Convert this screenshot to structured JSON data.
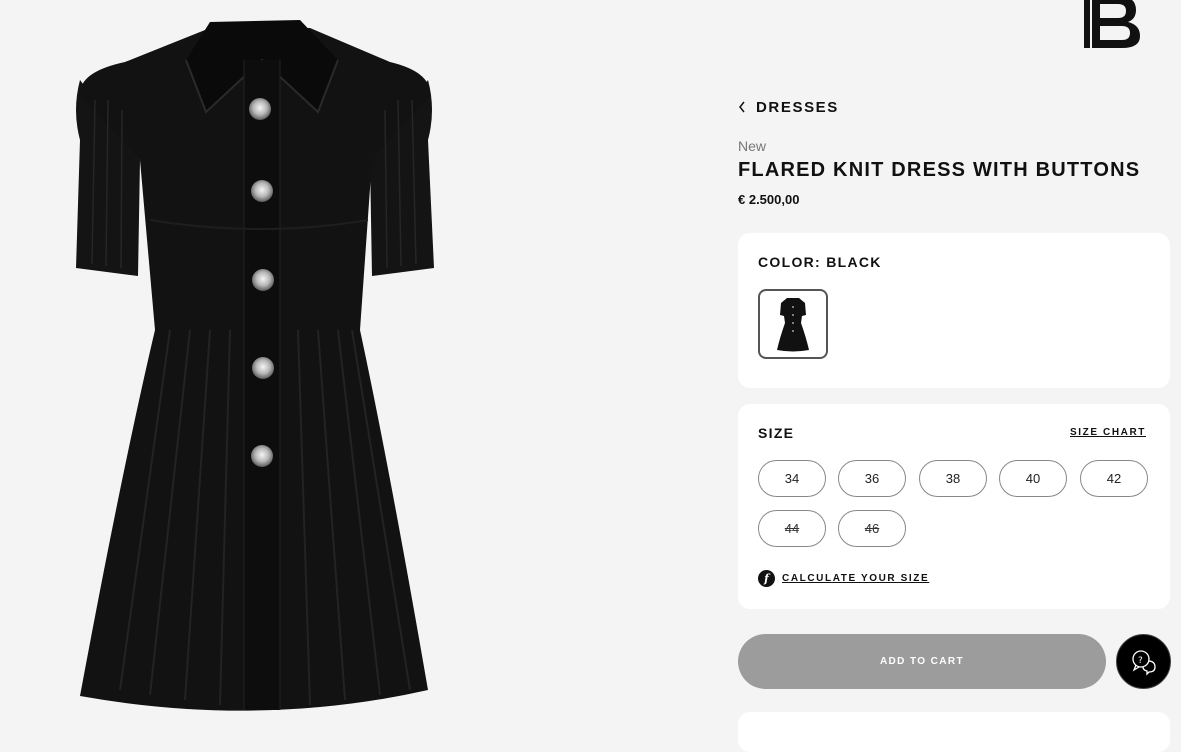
{
  "brand": {
    "logo_letter": "B"
  },
  "breadcrumb": {
    "icon": "chevron-left-icon",
    "label": "DRESSES"
  },
  "product": {
    "badge": "New",
    "title": "FLARED KNIT DRESS WITH BUTTONS",
    "price": "€ 2.500,00",
    "image_alt": "Black flared knit dress with silver buttons"
  },
  "color": {
    "label": "COLOR: BLACK",
    "swatches": [
      {
        "name": "black",
        "selected": true,
        "hex": "#111111"
      }
    ]
  },
  "size": {
    "label": "SIZE",
    "chart_link": "SIZE CHART",
    "options": [
      {
        "label": "34",
        "available": true
      },
      {
        "label": "36",
        "available": true
      },
      {
        "label": "38",
        "available": true
      },
      {
        "label": "40",
        "available": true
      },
      {
        "label": "42",
        "available": true
      },
      {
        "label": "44",
        "available": false
      },
      {
        "label": "46",
        "available": false
      }
    ],
    "calculator_icon": "f",
    "calculator_label": "CALCULATE YOUR SIZE"
  },
  "cart": {
    "add_label": "ADD TO CART",
    "button_color": "#9c9c9c"
  },
  "chat": {
    "icon": "chat-bubbles-icon"
  },
  "colors": {
    "background": "#f4f4f4",
    "card": "#ffffff",
    "text": "#111111",
    "muted": "#777777"
  }
}
